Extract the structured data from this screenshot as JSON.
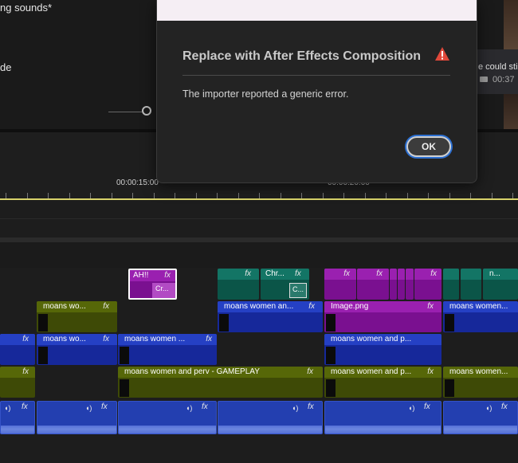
{
  "top_panel": {
    "text_line1": "ng sounds*",
    "text_line2": "de"
  },
  "right_panel": {
    "caption": "e could still",
    "time": "00:37"
  },
  "ruler": {
    "timecode_1": "00:00:15:00",
    "timecode_2": "00:00:20:00"
  },
  "dialog": {
    "title": "Replace with After Effects Composition",
    "message": "The importer reported a generic error.",
    "ok_label": "OK",
    "warning_icon": "warning-triangle-icon",
    "warning_color": "#e0483a"
  },
  "tracks": {
    "v5": {
      "clip_ah": "AH!!",
      "clip_cr": "Cr...",
      "clip_chr": "Chr...",
      "clip_c": "C...",
      "clip_n": "n..."
    },
    "v4": {
      "clip1": "moans wo...",
      "clip2": "moans women an...",
      "clip3": "Image.png",
      "clip4": "moans women..."
    },
    "v3": {
      "clip1": "moans wo...",
      "clip2": "moans women ...",
      "clip3": "moans women and p..."
    },
    "v2": {
      "clip1": "moans women and perv - GAMEPLAY",
      "clip2": "moans women and p...",
      "clip3": "moans women..."
    },
    "fx_label": "fx"
  },
  "colors": {
    "video_olive": "#566708",
    "video_blue": "#2540c4",
    "video_purple": "#9a20b0",
    "video_teal": "#137565",
    "playhead_line": "#d8d26a"
  }
}
